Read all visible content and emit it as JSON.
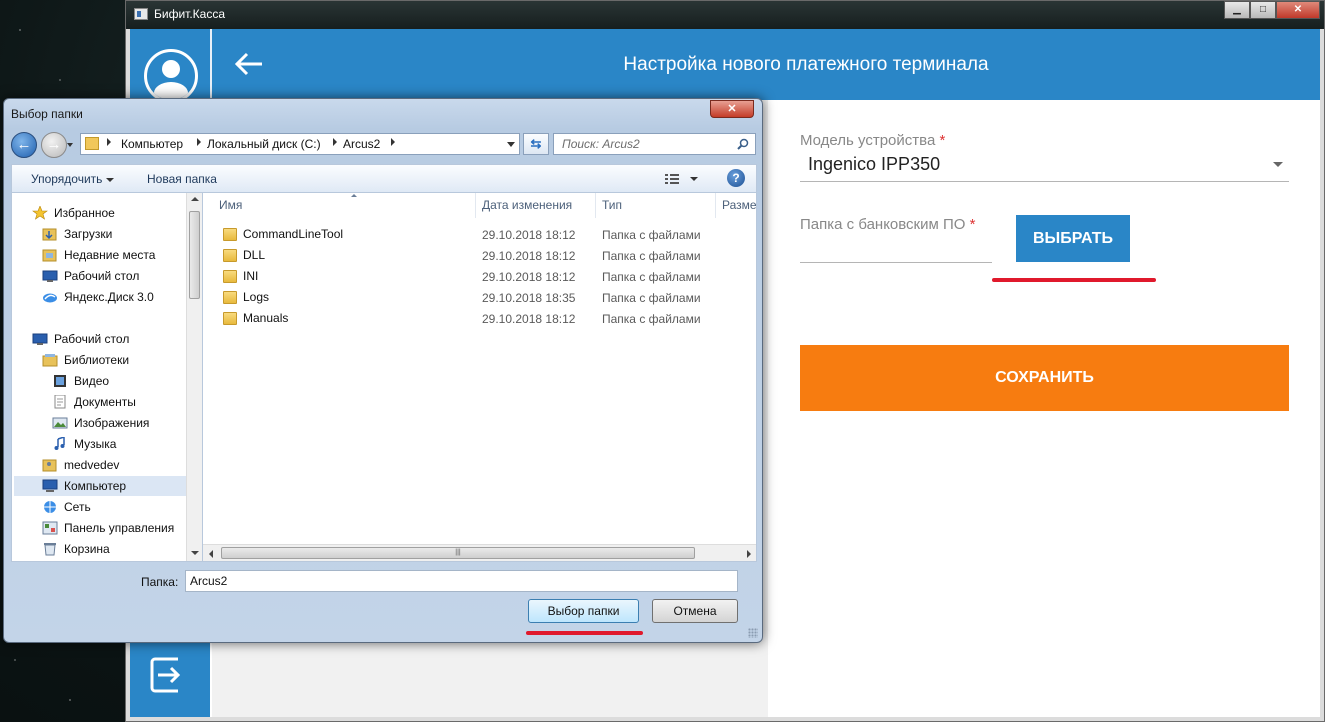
{
  "app": {
    "title": "Бифит.Касса",
    "header_title": "Настройка нового платежного терминала",
    "form": {
      "model_label": "Модель устройства",
      "required_mark": "*",
      "model_value": "Ingenico IPP350",
      "folder_label": "Папка с банковским ПО",
      "choose_button": "ВЫБРАТЬ",
      "save_button": "СОХРАНИТЬ"
    },
    "colors": {
      "accent_blue": "#2a86c7",
      "save_orange": "#f77c10",
      "highlight_red": "#e0192c"
    }
  },
  "dialog": {
    "title": "Выбор папки",
    "breadcrumb": [
      "Компьютер",
      "Локальный диск (C:)",
      "Arcus2"
    ],
    "search_placeholder": "Поиск: Arcus2",
    "toolbar": {
      "organize": "Упорядочить",
      "new_folder": "Новая папка"
    },
    "tree": {
      "favorites": "Избранное",
      "downloads": "Загрузки",
      "recent": "Недавние места",
      "desktop_fav": "Рабочий стол",
      "yandex": "Яндекс.Диск 3.0",
      "desktop": "Рабочий стол",
      "libraries": "Библиотеки",
      "video": "Видео",
      "documents": "Документы",
      "images": "Изображения",
      "music": "Музыка",
      "user": "medvedev",
      "computer": "Компьютер",
      "network": "Сеть",
      "control_panel": "Панель управления",
      "recycle": "Корзина"
    },
    "columns": {
      "name": "Имя",
      "modified": "Дата изменения",
      "type": "Тип",
      "size": "Разме"
    },
    "files": [
      {
        "name": "CommandLineTool",
        "modified": "29.10.2018 18:12",
        "type": "Папка с файлами"
      },
      {
        "name": "DLL",
        "modified": "29.10.2018 18:12",
        "type": "Папка с файлами"
      },
      {
        "name": "INI",
        "modified": "29.10.2018 18:12",
        "type": "Папка с файлами"
      },
      {
        "name": "Logs",
        "modified": "29.10.2018 18:35",
        "type": "Папка с файлами"
      },
      {
        "name": "Manuals",
        "modified": "29.10.2018 18:12",
        "type": "Папка с файлами"
      }
    ],
    "folder_label": "Папка:",
    "folder_value": "Arcus2",
    "select_button": "Выбор папки",
    "cancel_button": "Отмена"
  }
}
